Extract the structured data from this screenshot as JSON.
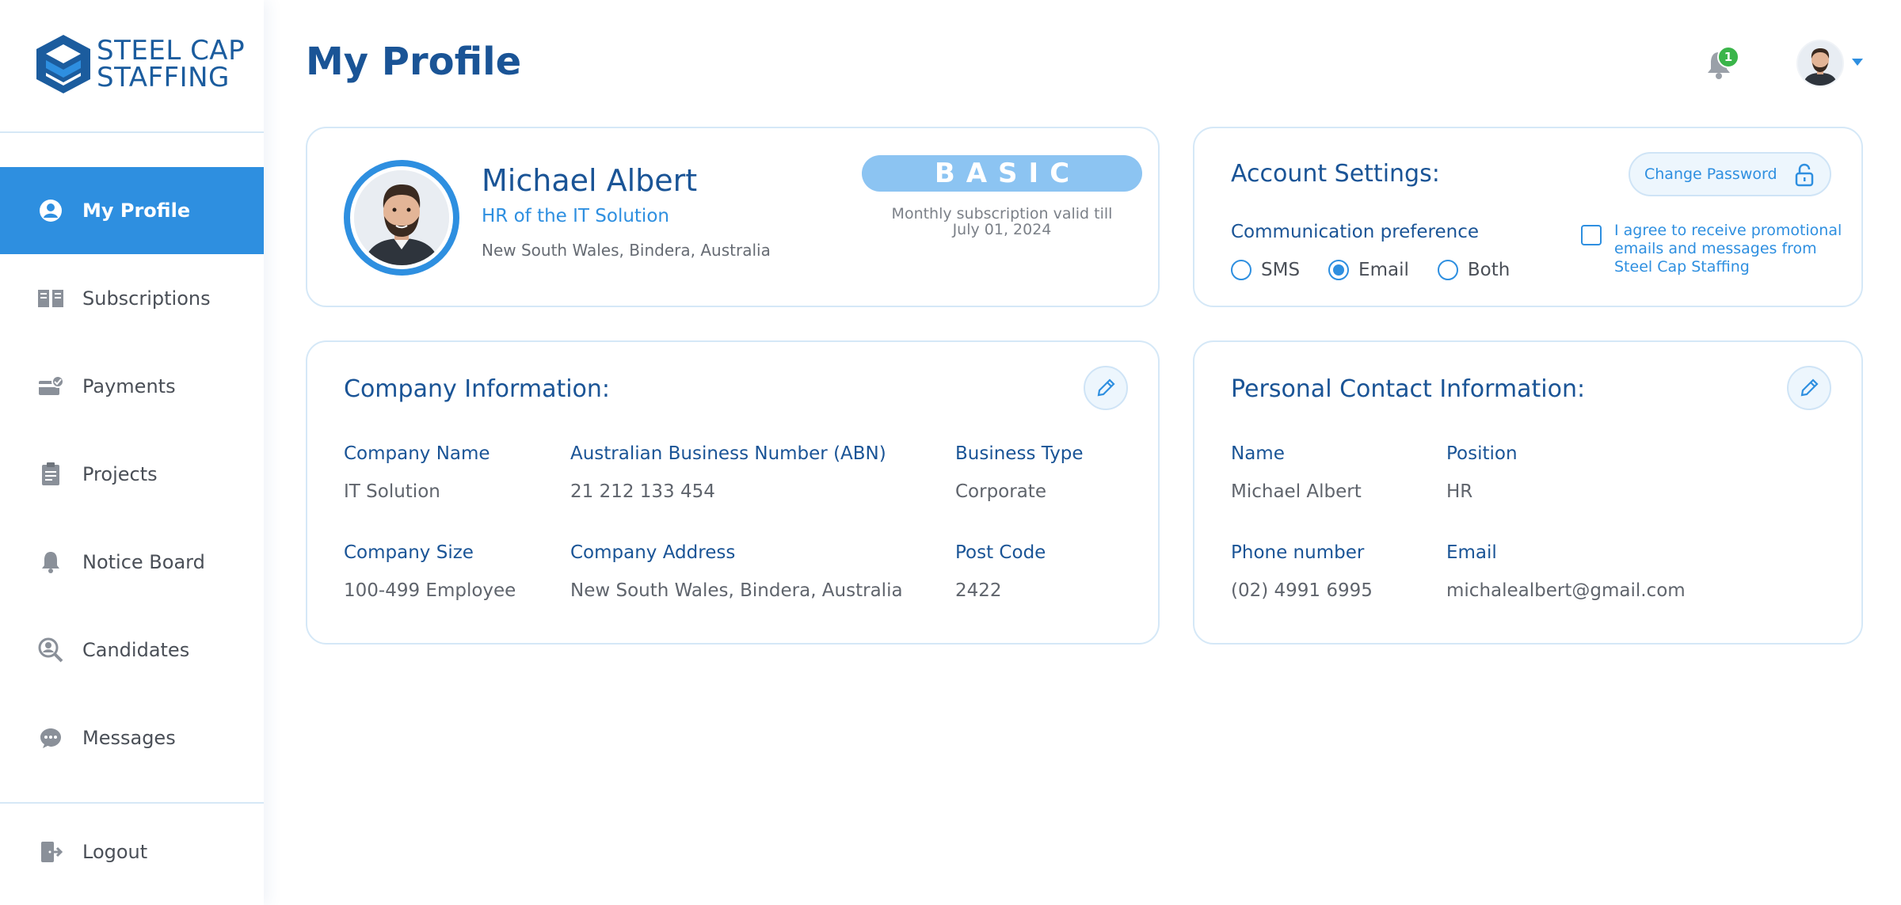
{
  "brand": {
    "line1": "STEEL CAP",
    "line2": "STAFFING",
    "color": "#1b5c9e"
  },
  "sidebar": {
    "items": [
      {
        "label": "My Profile",
        "icon": "user-circle-icon",
        "active": true
      },
      {
        "label": "Subscriptions",
        "icon": "book-icon"
      },
      {
        "label": "Payments",
        "icon": "payment-icon"
      },
      {
        "label": "Projects",
        "icon": "clipboard-icon"
      },
      {
        "label": "Notice Board",
        "icon": "bell-icon"
      },
      {
        "label": "Candidates",
        "icon": "candidate-search-icon"
      },
      {
        "label": "Messages",
        "icon": "chat-icon"
      }
    ],
    "logout": {
      "label": "Logout",
      "icon": "logout-icon"
    }
  },
  "header": {
    "title": "My Profile",
    "notification_count": "1"
  },
  "profile": {
    "name": "Michael Albert",
    "role": "HR of the IT Solution",
    "location": "New South Wales, Bindera, Australia",
    "plan": "BASIC",
    "plan_note_line1": "Monthly subscription valid till",
    "plan_note_line2": "July 01, 2024"
  },
  "account": {
    "title": "Account Settings:",
    "change_password": "Change Password",
    "comm_label": "Communication preference",
    "options": [
      "SMS",
      "Email",
      "Both"
    ],
    "selected": "Email",
    "agree_text": "I agree to receive promotional emails and messages from Steel Cap Staffing"
  },
  "company": {
    "title": "Company Information:",
    "fields": {
      "name_label": "Company Name",
      "name_value": "IT Solution",
      "abn_label": "Australian Business Number (ABN)",
      "abn_value": "21 212 133 454",
      "type_label": "Business Type",
      "type_value": "Corporate",
      "size_label": "Company Size",
      "size_value": "100-499 Employee",
      "address_label": "Company Address",
      "address_value": "New South Wales, Bindera, Australia",
      "postcode_label": "Post Code",
      "postcode_value": "2422"
    }
  },
  "personal": {
    "title": "Personal Contact Information:",
    "fields": {
      "name_label": "Name",
      "name_value": "Michael Albert",
      "position_label": "Position",
      "position_value": "HR",
      "phone_label": "Phone number",
      "phone_value": "(02) 4991 6995",
      "email_label": "Email",
      "email_value": "michalealbert@gmail.com"
    }
  },
  "colors": {
    "accent": "#2e8fe0",
    "heading": "#1a5496",
    "badge_green": "#3ab54a",
    "plan_badge": "#8cc4f2"
  }
}
